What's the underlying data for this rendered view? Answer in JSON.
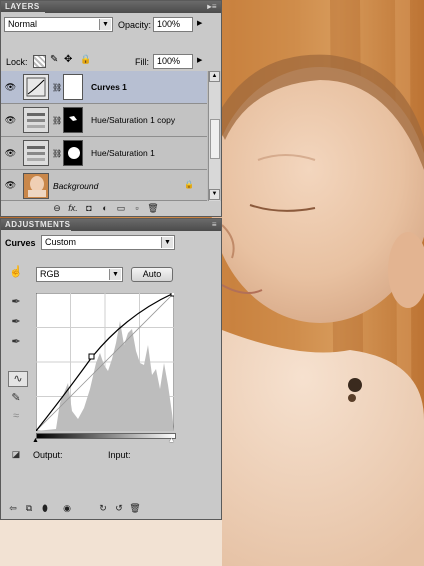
{
  "layers_panel": {
    "title": "LAYERS",
    "blend_mode": "Normal",
    "opacity_label": "Opacity:",
    "opacity_value": "100%",
    "lock_label": "Lock:",
    "fill_label": "Fill:",
    "fill_value": "100%",
    "layers": [
      {
        "name": "Curves 1",
        "selected": true,
        "visible": true
      },
      {
        "name": "Hue/Saturation 1 copy",
        "selected": false,
        "visible": true
      },
      {
        "name": "Hue/Saturation 1",
        "selected": false,
        "visible": true
      },
      {
        "name": "Background",
        "selected": false,
        "visible": true,
        "locked": true
      }
    ]
  },
  "adjustments_panel": {
    "title": "ADJUSTMENTS",
    "adjustment_label": "Curves",
    "preset": "Custom",
    "channel": "RGB",
    "auto_label": "Auto",
    "output_label": "Output:",
    "input_label": "Input:"
  },
  "colors": {
    "panel_bg": "#c9c9c9",
    "header_bg": "#4b4b4b",
    "selected_layer": "#b7bfd2",
    "photo_bg": "#c07a3a"
  }
}
